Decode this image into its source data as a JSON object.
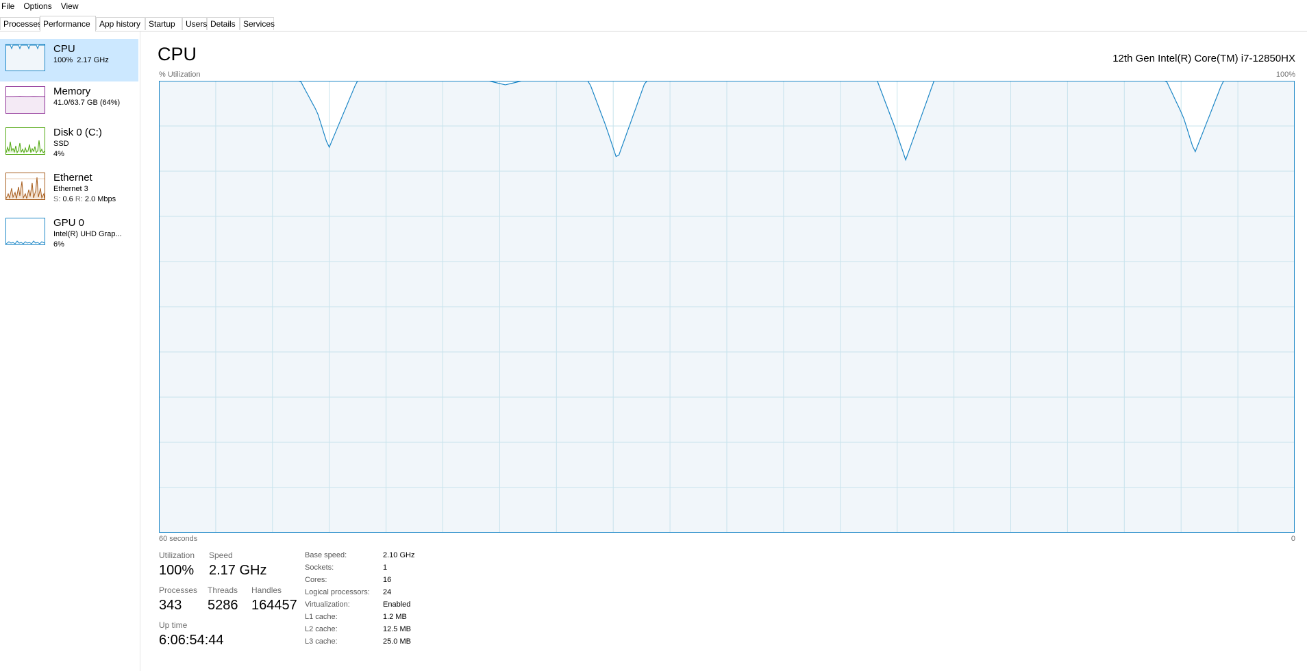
{
  "menu": [
    "File",
    "Options",
    "View"
  ],
  "tabs": [
    "Processes",
    "Performance",
    "App history",
    "Startup",
    "Users",
    "Details",
    "Services"
  ],
  "active_tab": "Performance",
  "sidebar": {
    "items": [
      {
        "title": "CPU",
        "line1": "100%  2.17 GHz",
        "line2": "",
        "color": "#1b86c6",
        "selected": true,
        "icon": "cpu-graph-icon"
      },
      {
        "title": "Memory",
        "line1": "41.0/63.7 GB (64%)",
        "line2": "",
        "color": "#8b2a93",
        "selected": false,
        "icon": "memory-graph-icon"
      },
      {
        "title": "Disk 0 (C:)",
        "line1": "SSD",
        "line2": "4%",
        "color": "#4da60c",
        "selected": false,
        "icon": "disk-graph-icon"
      },
      {
        "title": "Ethernet",
        "line1": "Ethernet 3",
        "line2_s": "S:",
        "line2_sv": "0.6",
        "line2_r": "R:",
        "line2_rv": "2.0 Mbps",
        "color": "#a65c1c",
        "selected": false,
        "icon": "ethernet-graph-icon"
      },
      {
        "title": "GPU 0",
        "line1": "Intel(R) UHD Grap...",
        "line2": "6%",
        "color": "#1b86c6",
        "selected": false,
        "icon": "gpu-graph-icon"
      }
    ]
  },
  "main": {
    "title": "CPU",
    "model": "12th Gen Intel(R) Core(TM) i7-12850HX",
    "graph": {
      "y_label": "% Utilization",
      "y_max_label": "100%",
      "x_left_label": "60 seconds",
      "x_right_label": "0",
      "line_color": "#1b86c6",
      "fill_color": "#f1f6fa",
      "grid_color": "#c7e3ec",
      "samples": [
        100,
        100,
        100,
        100,
        100,
        100,
        100,
        100,
        100,
        100,
        100,
        100,
        100,
        100,
        100,
        100,
        100,
        100,
        100,
        100,
        100,
        100,
        100,
        100,
        100,
        100,
        100,
        100,
        100,
        100,
        100,
        100,
        100,
        100,
        100,
        100,
        100,
        100,
        100,
        100,
        100,
        100,
        100,
        100,
        100,
        100,
        100,
        100,
        96,
        85,
        100,
        100,
        100,
        100,
        100,
        100,
        100,
        100,
        100,
        100,
        100,
        100,
        100,
        100,
        100,
        100,
        100,
        100,
        100,
        100,
        100,
        100,
        100,
        100,
        100,
        100,
        100,
        99.5,
        100,
        100,
        100,
        100,
        100,
        100,
        100,
        100,
        100,
        100,
        100,
        100,
        100,
        100,
        100,
        100,
        100,
        100,
        100,
        100,
        100,
        100,
        100,
        100,
        100,
        100,
        100,
        100,
        100,
        100,
        100,
        100,
        100,
        100,
        100,
        100,
        100,
        100,
        100,
        100,
        100,
        100,
        100,
        100,
        100,
        100,
        100,
        100,
        100,
        100,
        100,
        100,
        100,
        100,
        100,
        100,
        100,
        100,
        100,
        100,
        100,
        100,
        100,
        100,
        100,
        100,
        100,
        100,
        100,
        100,
        100,
        100,
        100,
        100,
        100,
        100,
        100,
        100,
        100,
        100,
        100,
        100,
        100,
        100,
        100,
        100,
        100,
        100,
        100,
        100,
        100,
        100,
        100,
        100,
        100,
        100,
        100,
        100,
        100,
        100,
        100,
        100,
        100,
        100,
        100,
        100,
        100,
        100,
        100,
        100,
        100,
        100,
        100,
        100,
        100,
        100,
        100,
        100,
        100,
        100,
        100,
        100,
        100,
        100,
        100,
        100,
        100,
        100,
        100,
        100,
        100,
        100,
        100,
        100,
        100,
        100,
        100,
        100,
        100,
        100,
        100,
        100,
        100,
        100,
        100,
        100,
        100,
        100,
        100,
        100,
        100,
        100,
        100,
        100,
        100,
        100,
        100,
        100,
        100,
        100,
        100,
        100,
        100,
        100,
        100,
        100,
        100,
        100,
        100,
        100,
        100
      ]
    },
    "dips": [
      {
        "start": 100,
        "p1": 93,
        "min": 85,
        "end": 100
      },
      {
        "start": 100,
        "p1": 90,
        "min": 82.5,
        "end": 100
      },
      {
        "start": 100,
        "p1": 90,
        "min": 82.5,
        "end": 100
      },
      {
        "start": 100,
        "p1": 92,
        "min": 84,
        "end": 100
      }
    ],
    "stats": {
      "utilization_label": "Utilization",
      "utilization_value": "100%",
      "speed_label": "Speed",
      "speed_value": "2.17 GHz",
      "processes_label": "Processes",
      "processes_value": "343",
      "threads_label": "Threads",
      "threads_value": "5286",
      "handles_label": "Handles",
      "handles_value": "164457",
      "uptime_label": "Up time",
      "uptime_value": "6:06:54:44"
    },
    "specs": [
      {
        "k": "Base speed:",
        "v": "2.10 GHz"
      },
      {
        "k": "Sockets:",
        "v": "1"
      },
      {
        "k": "Cores:",
        "v": "16"
      },
      {
        "k": "Logical processors:",
        "v": "24"
      },
      {
        "k": "Virtualization:",
        "v": "Enabled"
      },
      {
        "k": "L1 cache:",
        "v": "1.2 MB"
      },
      {
        "k": "L2 cache:",
        "v": "12.5 MB"
      },
      {
        "k": "L3 cache:",
        "v": "25.0 MB"
      }
    ]
  }
}
